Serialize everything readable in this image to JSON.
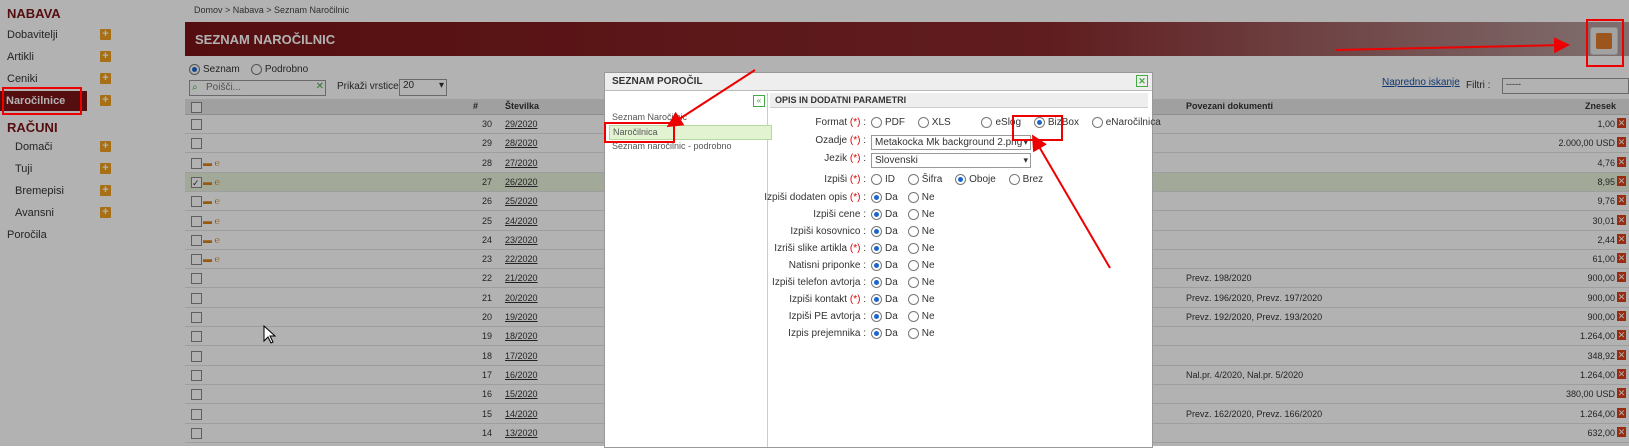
{
  "sidebar": {
    "nabava": "NABAVA",
    "dobavitelji": "Dobavitelji",
    "artikli": "Artikli",
    "ceniki": "Ceniki",
    "narocilnice": "Naročilnice",
    "racuni": "RAČUNI",
    "domaci": "Domači",
    "tuji": "Tuji",
    "bremepisi": "Bremepisi",
    "avansni": "Avansni",
    "porocila": "Poročila"
  },
  "breadcrumb": "Domov  >  Nabava  >  Seznam Naročilnic",
  "page_title": "SEZNAM NAROČILNIC",
  "view": {
    "seznam": "Seznam",
    "podrobno": "Podrobno"
  },
  "search_placeholder": "Poišči...",
  "rows_label": "Prikaži vrstice:",
  "rows_value": "20",
  "advanced_search": "Napredno iskanje",
  "filter_label": "Filtri :",
  "filter_value": "-----",
  "table": {
    "col_num": "#",
    "col_doc": "Številka",
    "col_rel": "Povezani dokumenti",
    "col_amt": "Znesek",
    "rows": [
      {
        "n": "30",
        "doc": "29/2020",
        "rel": "",
        "amt": "1,00"
      },
      {
        "n": "29",
        "doc": "28/2020",
        "rel": "",
        "amt": "2.000,00 USD"
      },
      {
        "n": "28",
        "doc": "27/2020",
        "rel": "",
        "amt": "4,76"
      },
      {
        "n": "27",
        "doc": "26/2020",
        "rel": "",
        "amt": "8,95"
      },
      {
        "n": "26",
        "doc": "25/2020",
        "rel": "",
        "amt": "9,76"
      },
      {
        "n": "25",
        "doc": "24/2020",
        "rel": "",
        "amt": "30,01"
      },
      {
        "n": "24",
        "doc": "23/2020",
        "rel": "",
        "amt": "2,44"
      },
      {
        "n": "23",
        "doc": "22/2020",
        "rel": "",
        "amt": "61,00"
      },
      {
        "n": "22",
        "doc": "21/2020",
        "rel": "Prevz. 198/2020",
        "amt": "900,00"
      },
      {
        "n": "21",
        "doc": "20/2020",
        "rel": "Prevz. 196/2020, Prevz. 197/2020",
        "amt": "900,00"
      },
      {
        "n": "20",
        "doc": "19/2020",
        "rel": "Prevz. 192/2020, Prevz. 193/2020",
        "amt": "900,00"
      },
      {
        "n": "19",
        "doc": "18/2020",
        "rel": "",
        "amt": "1.264,00"
      },
      {
        "n": "18",
        "doc": "17/2020",
        "rel": "",
        "amt": "348,92"
      },
      {
        "n": "17",
        "doc": "16/2020",
        "rel": "Nal.pr. 4/2020, Nal.pr. 5/2020",
        "amt": "1.264,00"
      },
      {
        "n": "16",
        "doc": "15/2020",
        "rel": "",
        "amt": "380,00 USD"
      },
      {
        "n": "15",
        "doc": "14/2020",
        "rel": "Prevz. 162/2020, Prevz. 166/2020",
        "amt": "1.264,00"
      },
      {
        "n": "14",
        "doc": "13/2020",
        "rel": "",
        "amt": "632,00"
      }
    ]
  },
  "modal": {
    "title": "SEZNAM POROČIL",
    "reports": [
      "Seznam Naročilnic",
      "Naročilnica",
      "Seznam naročilnic - podrobno"
    ],
    "right_title": "OPIS IN DODATNI PARAMETRI",
    "format_label": "Format",
    "format_options": [
      "PDF",
      "XLS",
      "eSlog",
      "BizBox",
      "eNaročilnica"
    ],
    "ozadje_label": "Ozadje",
    "ozadje_value": "Metakocka Mk background 2.png",
    "jezik_label": "Jezik",
    "jezik_value": "Slovenski",
    "izpisi_label": "Izpiši",
    "izpisi_options": [
      "ID",
      "Šifra",
      "Oboje",
      "Brez"
    ],
    "req_mark": "(*)",
    "da": "Da",
    "ne": "Ne",
    "yn_rows": [
      {
        "label": "Izpiši dodaten opis",
        "req": true
      },
      {
        "label": "Izpiši cene",
        "req": false
      },
      {
        "label": "Izpiši kosovnico",
        "req": false
      },
      {
        "label": "Izriši slike artikla",
        "req": true
      },
      {
        "label": "Natisni priponke",
        "req": false
      },
      {
        "label": "Izpiši telefon avtorja",
        "req": false
      },
      {
        "label": "Izpiši kontakt",
        "req": true
      },
      {
        "label": "Izpiši PE avtorja",
        "req": false
      },
      {
        "label": "Izpis prejemnika",
        "req": false
      }
    ]
  },
  "colors": {
    "brand": "#7a1518",
    "annotation": "#e00000",
    "selected": "#e2f3d2"
  }
}
